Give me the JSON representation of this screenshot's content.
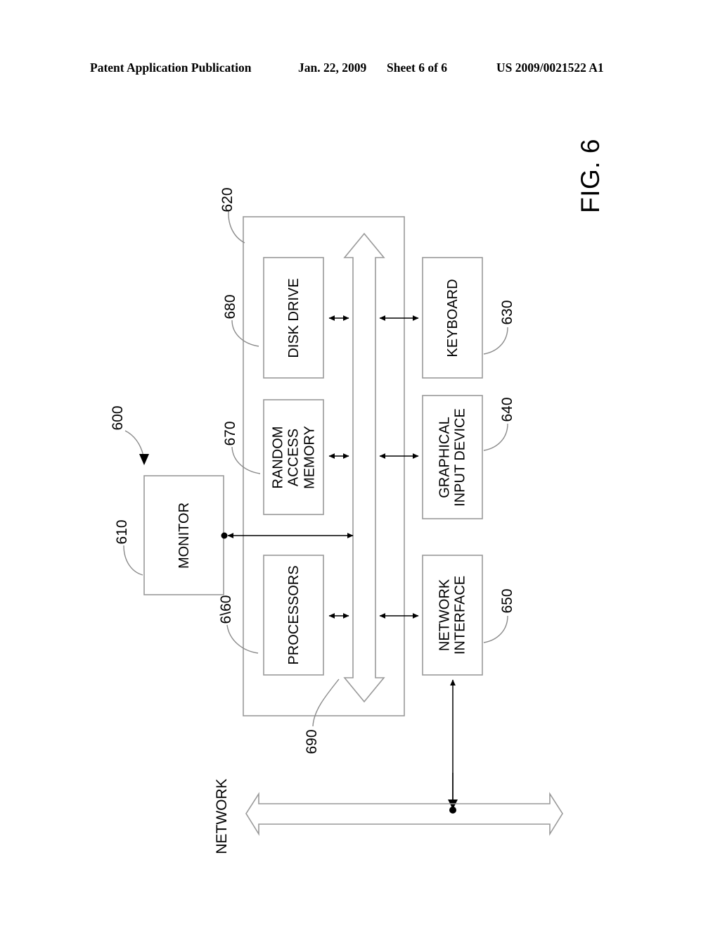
{
  "header": {
    "publication": "Patent Application Publication",
    "date": "Jan. 22, 2009",
    "sheet": "Sheet 6 of 6",
    "number": "US 2009/0021522 A1"
  },
  "figure": {
    "label": "FIG. 6",
    "system_ref": "600"
  },
  "diagram": {
    "type": "block-diagram",
    "orientation": "rotated-90-ccw",
    "outer_enclosure": {
      "name": "computer-system-enclosure",
      "ref": "620"
    },
    "bus": {
      "name": "system-bus",
      "ref": "690",
      "style": "double-headed-hollow-arrow"
    },
    "blocks": [
      {
        "id": "monitor",
        "label": "MONITOR",
        "ref": "610",
        "lines": [
          "MONITOR"
        ]
      },
      {
        "id": "disk-drive",
        "label": "DISK DRIVE",
        "ref": "680",
        "lines": [
          "DISK DRIVE"
        ]
      },
      {
        "id": "random-access-memory",
        "label": "RANDOM ACCESS MEMORY",
        "ref": "670",
        "lines": [
          "RANDOM",
          "ACCESS",
          "MEMORY"
        ]
      },
      {
        "id": "processors",
        "label": "PROCESSORS",
        "ref": "6\\60",
        "lines": [
          "PROCESSORS"
        ]
      },
      {
        "id": "keyboard",
        "label": "KEYBOARD",
        "ref": "630",
        "lines": [
          "KEYBOARD"
        ]
      },
      {
        "id": "graphical-input-device",
        "label": "GRAPHICAL INPUT DEVICE",
        "ref": "640",
        "lines": [
          "GRAPHICAL",
          "INPUT DEVICE"
        ]
      },
      {
        "id": "network-interface",
        "label": "NETWORK INTERFACE",
        "ref": "650",
        "lines": [
          "NETWORK",
          "INTERFACE"
        ]
      }
    ],
    "network": {
      "name": "network",
      "label": "NETWORK",
      "style": "double-headed-hollow-arrow"
    },
    "colors": {
      "line": "#999999",
      "text": "#000000",
      "leader": "#8a8a8a",
      "background": "#ffffff"
    }
  }
}
